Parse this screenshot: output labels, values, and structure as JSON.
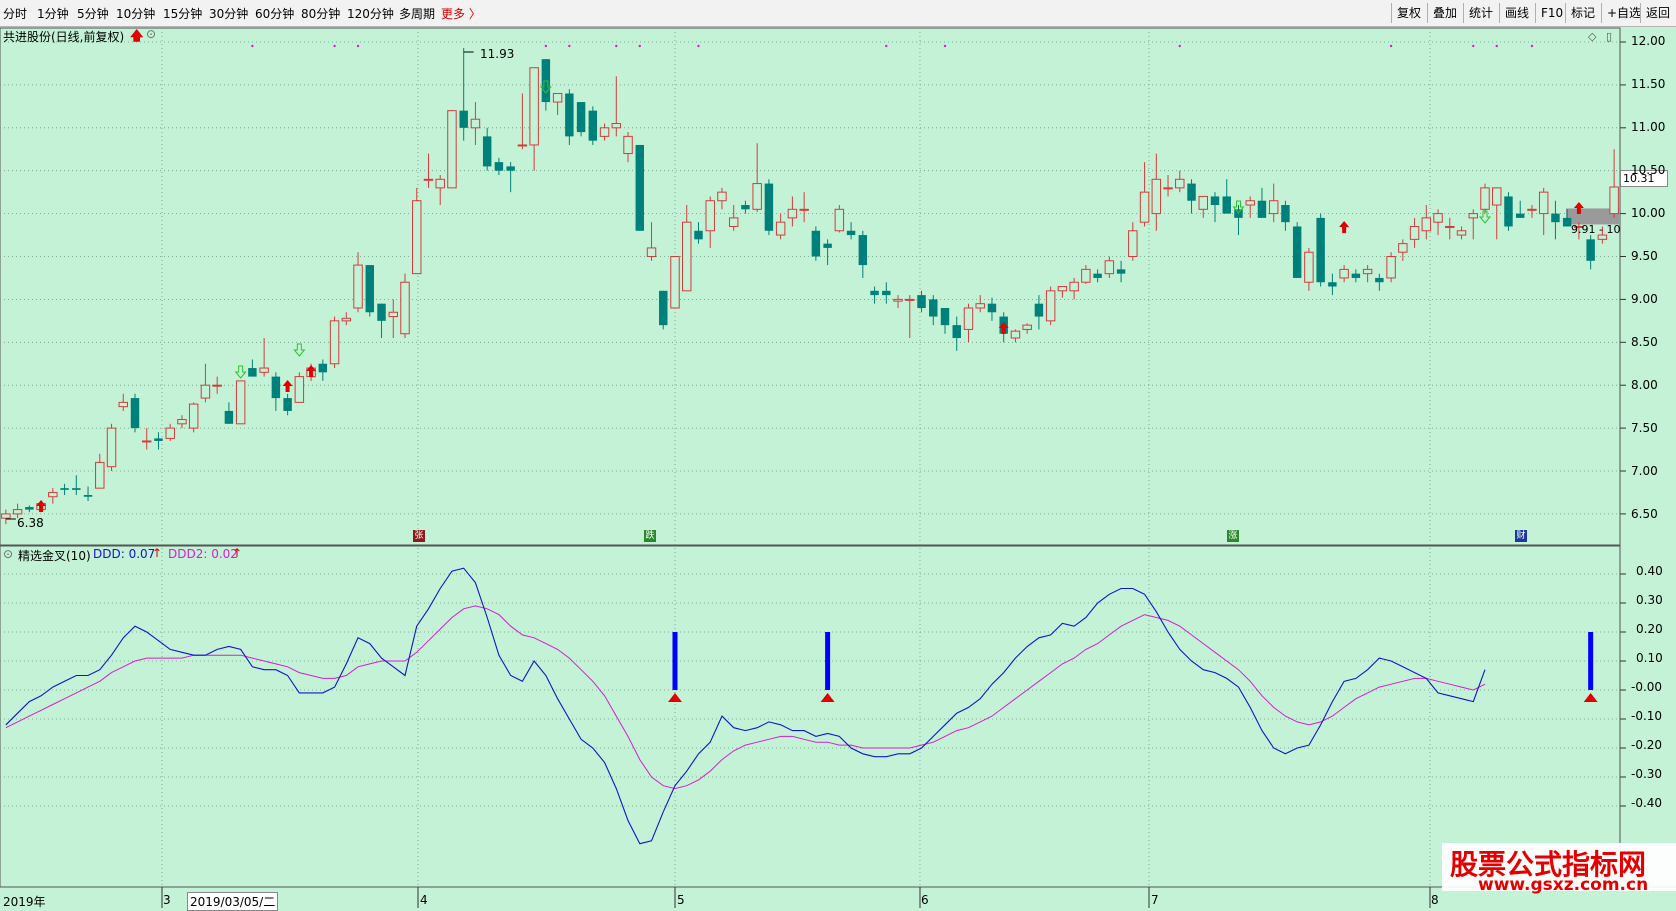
{
  "toolbar": {
    "periods": [
      "分时",
      "1分钟",
      "5分钟",
      "10分钟",
      "15分钟",
      "30分钟",
      "60分钟",
      "80分钟",
      "120分钟",
      "多周期",
      "更多 〉"
    ],
    "right_buttons": [
      "复权",
      "叠加",
      "统计",
      "画线",
      "F10",
      "标记",
      "+自选",
      "返回"
    ]
  },
  "main_chart": {
    "stock_title": "共进股份(日线,前复权)",
    "y_ticks": [
      "12.00",
      "11.50",
      "11.00",
      "10.50",
      "10.00",
      "9.50",
      "9.00",
      "8.50",
      "8.00",
      "7.50",
      "7.00",
      "6.50"
    ],
    "current_price": "10.31",
    "high_label": "11.93",
    "low_label": "6.38",
    "range_label": "9.91 - 10",
    "event_markers": [
      "张",
      "跌",
      "涨",
      "财"
    ]
  },
  "indicator": {
    "name": "精选金叉(10)",
    "ddd_label": "DDD: 0.07",
    "ddd2_label": "DDD2: 0.02",
    "y_ticks": [
      "0.40",
      "0.30",
      "0.20",
      "0.10",
      "-0.00",
      "-0.10",
      "-0.20",
      "-0.30",
      "-0.40"
    ]
  },
  "time_axis": {
    "labels": [
      "2019年",
      "3",
      "2019/03/05/二",
      "4",
      "5",
      "6",
      "7",
      "8"
    ]
  },
  "watermark": {
    "title": "股票公式指标网",
    "url": "www.gsxz.com.cn"
  },
  "colors": {
    "background": "#c4f2d6",
    "up_candle": "#d23c3c",
    "down_candle": "#00807a",
    "ddd_line": "#1414c8",
    "ddd2_line": "#d020d0",
    "signal_bar": "#0000ff",
    "arrow": "#e00000",
    "watermark": "#e30000"
  },
  "chart_data": [
    {
      "type": "candlestick",
      "title": "共进股份(日线,前复权)",
      "ylim": [
        6.3,
        12.1
      ],
      "y_ticks": [
        6.5,
        7.0,
        7.5,
        8.0,
        8.5,
        9.0,
        9.5,
        10.0,
        10.5,
        11.0,
        11.5,
        12.0
      ],
      "x_labels": [
        "3",
        "4",
        "5",
        "6",
        "7",
        "8"
      ],
      "ohlc": [
        [
          6.45,
          6.55,
          6.38,
          6.5
        ],
        [
          6.5,
          6.62,
          6.45,
          6.55
        ],
        [
          6.58,
          6.6,
          6.52,
          6.55
        ],
        [
          6.55,
          6.65,
          6.52,
          6.62
        ],
        [
          6.7,
          6.8,
          6.62,
          6.75
        ],
        [
          6.8,
          6.85,
          6.72,
          6.78
        ],
        [
          6.8,
          6.95,
          6.72,
          6.78
        ],
        [
          6.72,
          6.82,
          6.65,
          6.7
        ],
        [
          6.8,
          7.2,
          6.8,
          7.1
        ],
        [
          7.05,
          7.55,
          7.0,
          7.5
        ],
        [
          7.75,
          7.9,
          7.7,
          7.8
        ],
        [
          7.85,
          7.9,
          7.45,
          7.5
        ],
        [
          7.35,
          7.5,
          7.25,
          7.35
        ],
        [
          7.38,
          7.45,
          7.25,
          7.35
        ],
        [
          7.38,
          7.55,
          7.35,
          7.5
        ],
        [
          7.55,
          7.65,
          7.5,
          7.6
        ],
        [
          7.5,
          7.8,
          7.45,
          7.78
        ],
        [
          7.85,
          8.25,
          7.8,
          8.0
        ],
        [
          8.0,
          8.1,
          7.9,
          8.0
        ],
        [
          7.7,
          7.8,
          7.55,
          7.55
        ],
        [
          7.55,
          8.05,
          7.55,
          8.05
        ],
        [
          8.2,
          8.3,
          8.15,
          8.1
        ],
        [
          8.15,
          8.55,
          8.1,
          8.2
        ],
        [
          8.1,
          8.15,
          7.7,
          7.85
        ],
        [
          7.85,
          7.9,
          7.65,
          7.7
        ],
        [
          7.8,
          8.15,
          7.8,
          8.1
        ],
        [
          8.1,
          8.25,
          8.05,
          8.2
        ],
        [
          8.25,
          8.3,
          8.05,
          8.15
        ],
        [
          8.25,
          8.8,
          8.2,
          8.75
        ],
        [
          8.75,
          8.85,
          8.7,
          8.78
        ],
        [
          8.9,
          9.55,
          8.85,
          9.4
        ],
        [
          9.4,
          9.4,
          8.8,
          8.85
        ],
        [
          8.95,
          8.95,
          8.55,
          8.75
        ],
        [
          8.8,
          9.0,
          8.55,
          8.85
        ],
        [
          8.6,
          9.3,
          8.55,
          9.2
        ],
        [
          9.3,
          10.3,
          9.3,
          10.15
        ],
        [
          10.4,
          10.7,
          10.3,
          10.4
        ],
        [
          10.3,
          10.45,
          10.1,
          10.4
        ],
        [
          10.3,
          11.1,
          10.3,
          11.2
        ],
        [
          11.2,
          11.93,
          10.85,
          11.0
        ],
        [
          11.0,
          11.3,
          10.8,
          11.1
        ],
        [
          10.9,
          11.0,
          10.5,
          10.55
        ],
        [
          10.6,
          10.65,
          10.45,
          10.5
        ],
        [
          10.55,
          10.6,
          10.25,
          10.5
        ],
        [
          10.8,
          11.4,
          10.75,
          10.8
        ],
        [
          10.8,
          11.5,
          10.5,
          11.7
        ],
        [
          11.8,
          11.8,
          11.2,
          11.3
        ],
        [
          11.3,
          11.35,
          11.15,
          11.4
        ],
        [
          11.4,
          11.45,
          10.8,
          10.9
        ],
        [
          11.3,
          11.3,
          10.9,
          10.95
        ],
        [
          11.2,
          11.25,
          10.8,
          10.85
        ],
        [
          10.9,
          11.05,
          10.85,
          11.0
        ],
        [
          11.0,
          11.6,
          10.9,
          11.05
        ],
        [
          10.7,
          10.95,
          10.6,
          10.9
        ],
        [
          10.8,
          10.8,
          9.8,
          9.8
        ],
        [
          9.5,
          9.9,
          9.45,
          9.6
        ],
        [
          9.1,
          9.1,
          8.65,
          8.7
        ],
        [
          8.9,
          9.4,
          8.9,
          9.5
        ],
        [
          9.1,
          10.1,
          9.1,
          9.9
        ],
        [
          9.8,
          9.9,
          9.65,
          9.7
        ],
        [
          9.8,
          10.2,
          9.6,
          10.15
        ],
        [
          10.15,
          10.3,
          10.05,
          10.25
        ],
        [
          9.85,
          10.1,
          9.8,
          9.95
        ],
        [
          10.1,
          10.15,
          10.0,
          10.05
        ],
        [
          10.05,
          10.82,
          10.02,
          10.35
        ],
        [
          10.35,
          10.4,
          9.75,
          9.8
        ],
        [
          9.75,
          10.0,
          9.7,
          9.9
        ],
        [
          9.95,
          10.2,
          9.85,
          10.05
        ],
        [
          10.05,
          10.25,
          9.9,
          10.05
        ],
        [
          9.8,
          9.85,
          9.45,
          9.5
        ],
        [
          9.65,
          9.7,
          9.4,
          9.6
        ],
        [
          9.8,
          10.1,
          9.78,
          10.05
        ],
        [
          9.8,
          9.9,
          9.7,
          9.75
        ],
        [
          9.75,
          9.8,
          9.25,
          9.4
        ],
        [
          9.1,
          9.15,
          8.95,
          9.05
        ],
        [
          9.1,
          9.2,
          8.95,
          9.05
        ],
        [
          8.98,
          9.05,
          8.9,
          9.0
        ],
        [
          9.0,
          9.05,
          8.55,
          9.0
        ],
        [
          9.05,
          9.1,
          8.85,
          8.9
        ],
        [
          9.0,
          9.05,
          8.7,
          8.8
        ],
        [
          8.9,
          8.9,
          8.6,
          8.7
        ],
        [
          8.7,
          8.8,
          8.4,
          8.55
        ],
        [
          8.65,
          8.95,
          8.5,
          8.9
        ],
        [
          8.9,
          9.05,
          8.85,
          8.95
        ],
        [
          8.95,
          9.02,
          8.75,
          8.85
        ],
        [
          8.8,
          8.85,
          8.5,
          8.6
        ],
        [
          8.55,
          8.65,
          8.5,
          8.63
        ],
        [
          8.65,
          8.72,
          8.6,
          8.7
        ],
        [
          8.95,
          9.05,
          8.65,
          8.8
        ],
        [
          8.75,
          9.15,
          8.7,
          9.1
        ],
        [
          9.1,
          9.15,
          9.02,
          9.15
        ],
        [
          9.1,
          9.25,
          9.0,
          9.2
        ],
        [
          9.2,
          9.4,
          9.18,
          9.35
        ],
        [
          9.3,
          9.35,
          9.2,
          9.25
        ],
        [
          9.3,
          9.5,
          9.25,
          9.45
        ],
        [
          9.35,
          9.45,
          9.2,
          9.3
        ],
        [
          9.5,
          9.9,
          9.45,
          9.8
        ],
        [
          9.9,
          10.6,
          9.85,
          10.25
        ],
        [
          10.0,
          10.7,
          9.8,
          10.4
        ],
        [
          10.3,
          10.45,
          10.2,
          10.3
        ],
        [
          10.3,
          10.5,
          10.25,
          10.4
        ],
        [
          10.35,
          10.4,
          10.0,
          10.15
        ],
        [
          10.05,
          10.1,
          9.95,
          10.2
        ],
        [
          10.2,
          10.25,
          9.9,
          10.1
        ],
        [
          10.2,
          10.4,
          10.1,
          10.0
        ],
        [
          10.05,
          10.1,
          9.75,
          9.95
        ],
        [
          10.1,
          10.2,
          9.95,
          10.15
        ],
        [
          10.15,
          10.3,
          10.05,
          9.95
        ],
        [
          10.0,
          10.35,
          9.9,
          10.15
        ],
        [
          10.1,
          10.15,
          9.8,
          9.9
        ],
        [
          9.85,
          9.9,
          9.25,
          9.25
        ],
        [
          9.2,
          9.6,
          9.1,
          9.55
        ],
        [
          9.95,
          10.0,
          9.15,
          9.2
        ],
        [
          9.2,
          9.3,
          9.05,
          9.15
        ],
        [
          9.25,
          9.4,
          9.2,
          9.35
        ],
        [
          9.3,
          9.35,
          9.2,
          9.25
        ],
        [
          9.3,
          9.4,
          9.2,
          9.35
        ],
        [
          9.25,
          9.3,
          9.1,
          9.2
        ],
        [
          9.25,
          9.55,
          9.2,
          9.5
        ],
        [
          9.55,
          9.7,
          9.45,
          9.65
        ],
        [
          9.7,
          9.95,
          9.6,
          9.85
        ],
        [
          9.8,
          10.1,
          9.7,
          9.95
        ],
        [
          9.9,
          10.05,
          9.75,
          10.0
        ],
        [
          9.85,
          9.95,
          9.7,
          9.85
        ],
        [
          9.75,
          9.85,
          9.7,
          9.8
        ],
        [
          9.95,
          10.05,
          9.7,
          10.0
        ],
        [
          10.05,
          10.35,
          10.0,
          10.3
        ],
        [
          10.1,
          10.2,
          9.7,
          10.3
        ],
        [
          10.2,
          10.25,
          9.8,
          9.85
        ],
        [
          10.0,
          10.15,
          9.95,
          9.95
        ],
        [
          10.05,
          10.1,
          9.95,
          10.05
        ],
        [
          10.0,
          10.3,
          9.75,
          10.25
        ],
        [
          10.0,
          10.15,
          9.7,
          9.9
        ],
        [
          9.95,
          10.05,
          9.85,
          9.85
        ],
        [
          9.85,
          9.9,
          9.7,
          9.85
        ],
        [
          9.7,
          9.75,
          9.35,
          9.45
        ],
        [
          9.7,
          9.85,
          9.65,
          9.75
        ],
        [
          10.0,
          10.75,
          9.95,
          10.31
        ]
      ]
    },
    {
      "type": "line",
      "title": "精选金叉(10)",
      "ylim": [
        -0.5,
        0.45
      ],
      "y_ticks": [
        0.4,
        0.3,
        0.2,
        0.1,
        0.0,
        -0.1,
        -0.2,
        -0.3,
        -0.4
      ],
      "x_labels": [
        "2019年",
        "3",
        "2019/03/05/二",
        "4",
        "5",
        "6",
        "7",
        "8"
      ],
      "series": [
        {
          "name": "DDD",
          "values": [
            -0.12,
            -0.08,
            -0.04,
            -0.02,
            0.01,
            0.03,
            0.05,
            0.05,
            0.07,
            0.12,
            0.18,
            0.22,
            0.2,
            0.17,
            0.14,
            0.13,
            0.12,
            0.12,
            0.14,
            0.15,
            0.14,
            0.08,
            0.07,
            0.07,
            0.05,
            -0.01,
            -0.01,
            -0.01,
            0.01,
            0.09,
            0.18,
            0.16,
            0.11,
            0.08,
            0.05,
            0.22,
            0.28,
            0.35,
            0.41,
            0.42,
            0.37,
            0.25,
            0.12,
            0.05,
            0.03,
            0.1,
            0.05,
            -0.03,
            -0.1,
            -0.17,
            -0.2,
            -0.25,
            -0.34,
            -0.45,
            -0.53,
            -0.52,
            -0.42,
            -0.33,
            -0.28,
            -0.22,
            -0.18,
            -0.09,
            -0.13,
            -0.14,
            -0.13,
            -0.11,
            -0.12,
            -0.14,
            -0.14,
            -0.16,
            -0.15,
            -0.16,
            -0.2,
            -0.22,
            -0.23,
            -0.23,
            -0.22,
            -0.22,
            -0.2,
            -0.16,
            -0.12,
            -0.08,
            -0.06,
            -0.03,
            0.02,
            0.06,
            0.11,
            0.15,
            0.18,
            0.19,
            0.23,
            0.22,
            0.25,
            0.3,
            0.33,
            0.35,
            0.35,
            0.33,
            0.27,
            0.2,
            0.14,
            0.1,
            0.07,
            0.06,
            0.04,
            0.01,
            -0.06,
            -0.14,
            -0.2,
            -0.22,
            -0.2,
            -0.19,
            -0.12,
            -0.04,
            0.03,
            0.04,
            0.07,
            0.11,
            0.1,
            0.08,
            0.06,
            0.04,
            -0.01,
            -0.02,
            -0.03,
            -0.04,
            0.07
          ]
        },
        {
          "name": "DDD2",
          "values": [
            -0.13,
            -0.11,
            -0.09,
            -0.07,
            -0.05,
            -0.03,
            -0.01,
            0.01,
            0.03,
            0.06,
            0.08,
            0.1,
            0.11,
            0.11,
            0.11,
            0.11,
            0.12,
            0.12,
            0.12,
            0.12,
            0.12,
            0.11,
            0.1,
            0.09,
            0.08,
            0.06,
            0.05,
            0.04,
            0.04,
            0.05,
            0.08,
            0.09,
            0.1,
            0.1,
            0.1,
            0.13,
            0.17,
            0.21,
            0.25,
            0.28,
            0.29,
            0.28,
            0.26,
            0.22,
            0.19,
            0.18,
            0.16,
            0.14,
            0.11,
            0.07,
            0.03,
            -0.02,
            -0.09,
            -0.16,
            -0.24,
            -0.3,
            -0.33,
            -0.34,
            -0.33,
            -0.31,
            -0.28,
            -0.24,
            -0.21,
            -0.19,
            -0.18,
            -0.17,
            -0.16,
            -0.16,
            -0.17,
            -0.18,
            -0.18,
            -0.19,
            -0.19,
            -0.2,
            -0.2,
            -0.2,
            -0.2,
            -0.2,
            -0.19,
            -0.18,
            -0.16,
            -0.14,
            -0.13,
            -0.11,
            -0.09,
            -0.06,
            -0.03,
            0.0,
            0.03,
            0.06,
            0.09,
            0.11,
            0.14,
            0.16,
            0.19,
            0.22,
            0.24,
            0.26,
            0.25,
            0.24,
            0.22,
            0.19,
            0.16,
            0.13,
            0.1,
            0.07,
            0.03,
            -0.02,
            -0.06,
            -0.09,
            -0.11,
            -0.12,
            -0.11,
            -0.09,
            -0.06,
            -0.03,
            -0.01,
            0.01,
            0.02,
            0.03,
            0.04,
            0.04,
            0.03,
            0.02,
            0.01,
            0.0,
            0.02
          ]
        }
      ],
      "signals": [
        57,
        70,
        135
      ]
    }
  ]
}
